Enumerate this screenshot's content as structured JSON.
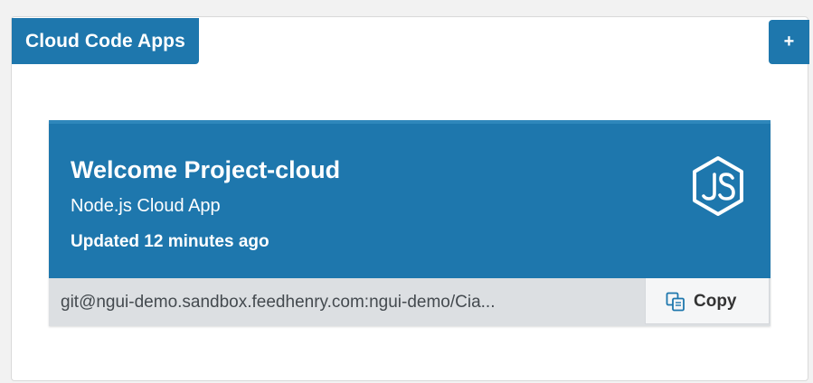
{
  "panel": {
    "title": "Cloud Code Apps",
    "add_button_label": "+"
  },
  "app": {
    "name": "Welcome Project-cloud",
    "type": "Node.js Cloud App",
    "updated": "Updated 12 minutes ago",
    "icon": "nodejs-icon",
    "git_url": "git@ngui-demo.sandbox.feedhenry.com:ngui-demo/Cia...",
    "copy_label": "Copy",
    "copy_icon": "copy-icon"
  },
  "colors": {
    "accent": "#1e77ad",
    "url_bar": "#dcdfe2",
    "copy_button": "#f5f6f7"
  }
}
